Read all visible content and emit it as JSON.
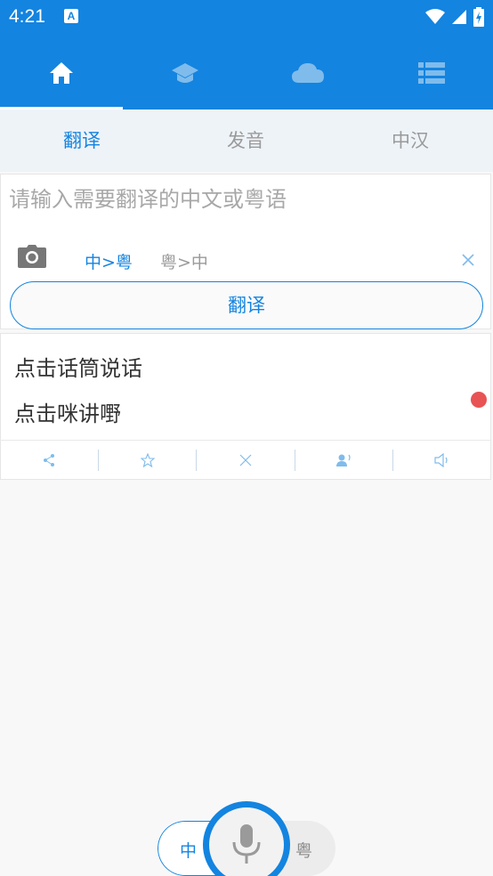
{
  "status_bar": {
    "time": "4:21",
    "notif_badge": "A"
  },
  "top_nav": {
    "tabs": [
      {
        "icon": "home-icon",
        "active": true
      },
      {
        "icon": "graduation-cap-icon",
        "active": false
      },
      {
        "icon": "cloud-icon",
        "active": false
      },
      {
        "icon": "list-icon",
        "active": false
      }
    ]
  },
  "sub_tabs": [
    "翻译",
    "发音",
    "中汉"
  ],
  "input": {
    "placeholder": "请输入需要翻译的中文或粤语"
  },
  "lang_options": {
    "zh_to_yue": "中>粤",
    "yue_to_zh": "粤>中"
  },
  "translate_button": "翻译",
  "result": {
    "line1": "点击话筒说话",
    "line2": "点击咪讲嘢"
  },
  "actions": [
    "share-icon",
    "star-icon",
    "close-icon",
    "speaker-person-icon",
    "volume-icon"
  ],
  "bottom": {
    "left_lang": "中",
    "right_lang": "粤"
  },
  "colors": {
    "accent": "#1384e0",
    "record_dot": "#e85353"
  }
}
